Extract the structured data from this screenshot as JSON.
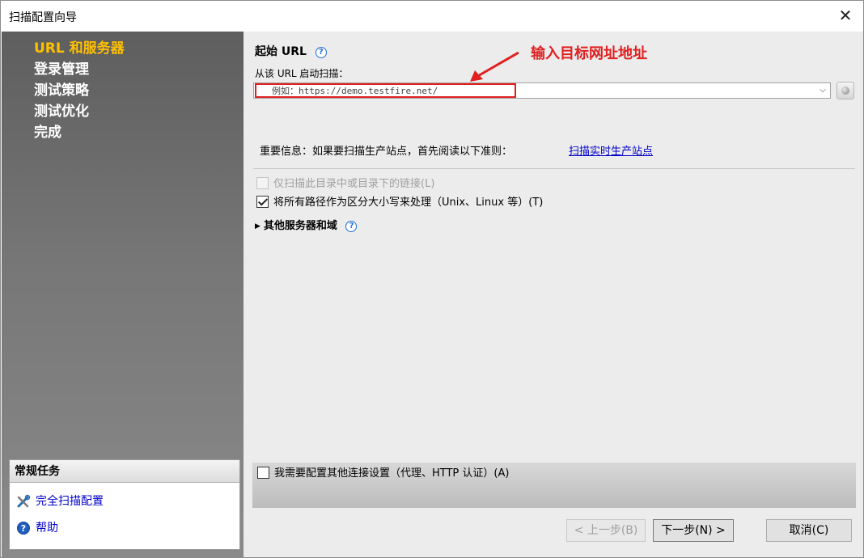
{
  "window": {
    "title": "扫描配置向导",
    "close_glyph": "✕"
  },
  "sidebar": {
    "steps": [
      {
        "label": "URL 和服务器",
        "active": true
      },
      {
        "label": "登录管理",
        "active": false
      },
      {
        "label": "测试策略",
        "active": false
      },
      {
        "label": "测试优化",
        "active": false
      },
      {
        "label": "完成",
        "active": false
      }
    ],
    "tasks_header": "常规任务",
    "tasks": [
      {
        "label": "完全扫描配置",
        "icon": "tools-icon"
      },
      {
        "label": "帮助",
        "icon": "help-icon"
      }
    ]
  },
  "main": {
    "section_title": "起始 URL",
    "url_label": "从该 URL 启动扫描：",
    "url_placeholder": "例如：https://demo.testfire.net/",
    "url_value": "",
    "annotation": "输入目标网址地址",
    "annotation_color": "#e02020",
    "notice": "重要信息：如果要扫描生产站点，首先阅读以下准则：",
    "notice_link": "扫描实时生产站点",
    "options": [
      {
        "label": "仅扫描此目录中或目录下的链接(L)",
        "checked": false,
        "enabled": false
      },
      {
        "label": "将所有路径作为区分大小写来处理（Unix、Linux 等）(T)",
        "checked": true,
        "enabled": true
      }
    ],
    "expander_label": "其他服务器和域",
    "connection_option": {
      "label": "我需要配置其他连接设置（代理、HTTP 认证）(A)",
      "checked": false
    }
  },
  "buttons": {
    "prev": "< 上一步(B)",
    "next": "下一步(N) >",
    "cancel": "取消(C)"
  }
}
